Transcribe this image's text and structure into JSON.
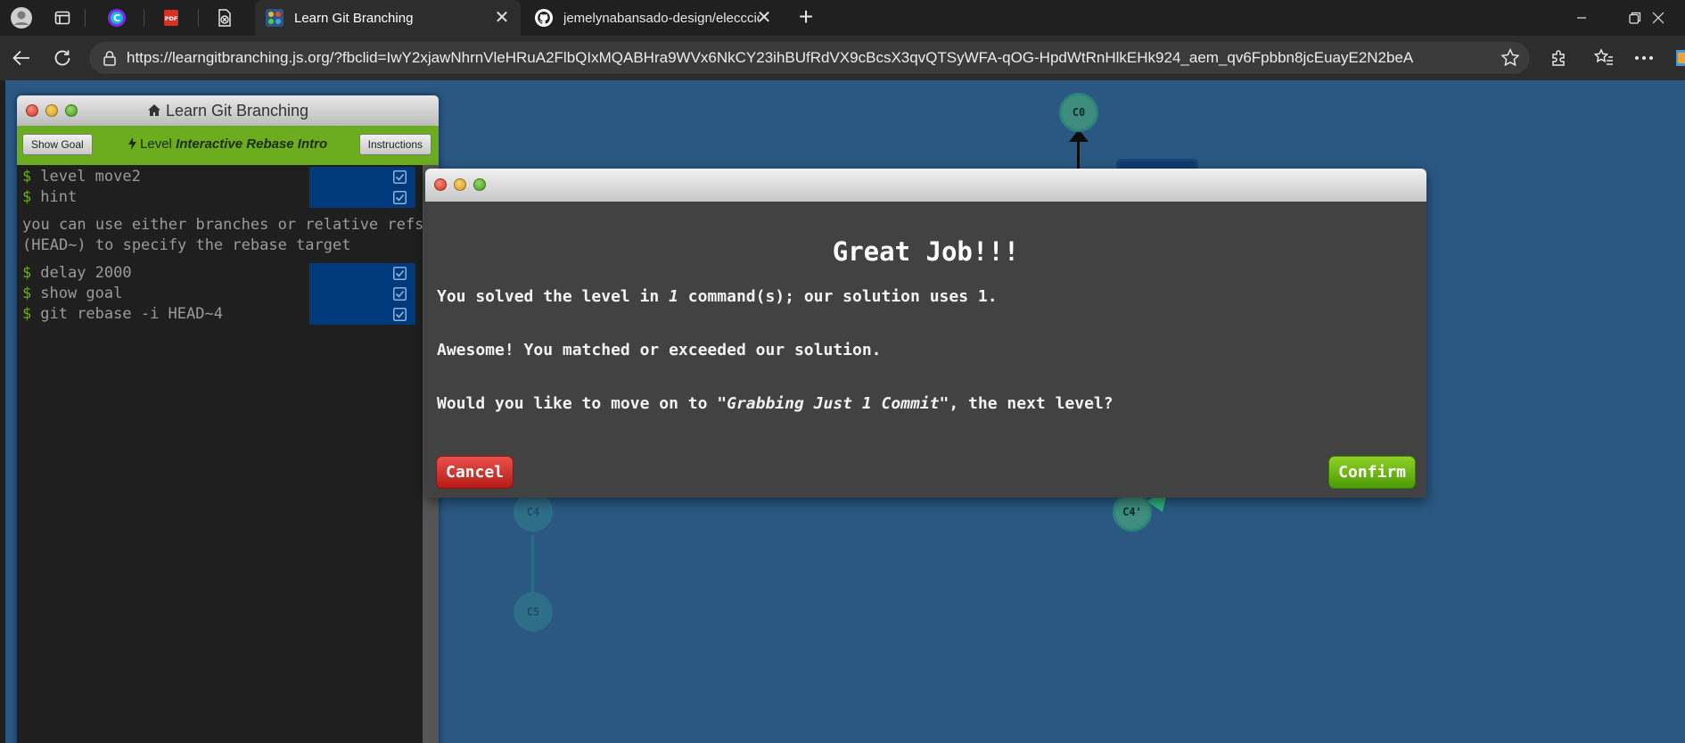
{
  "browser": {
    "tabs": [
      {
        "title": "Learn Git Branching",
        "active": true
      },
      {
        "title": "jemelynabansado-design/eleccción",
        "active": false
      }
    ],
    "close_glyph": "✕",
    "new_tab_glyph": "+",
    "url": "https://learngitbranching.js.org/?fbclid=IwY2xjawNhrnVleHRuA2FlbQIxMQABHra9WVx6NkCY23ihBUfRdVX9cBcsX3qvQTSyWFA-qOG-HpdWtRnHlkEHk924_aem_qv6Fpbbn8jcEuayE2N2beA"
  },
  "terminal": {
    "title": "Learn Git Branching",
    "show_goal_label": "Show Goal",
    "instructions_label": "Instructions",
    "level_prefix": "Level",
    "level_name": "Interactive Rebase Intro",
    "commands_top": [
      {
        "text": "level move2"
      },
      {
        "text": "hint"
      }
    ],
    "hint_text": "you can use either branches or relative refs (HEAD~) to specify the rebase target",
    "commands_bottom": [
      {
        "text": "delay 2000"
      },
      {
        "text": "show goal"
      },
      {
        "text": "git rebase -i HEAD~4"
      }
    ],
    "prompt": "$"
  },
  "tree": {
    "nodes": [
      {
        "label": "C0"
      },
      {
        "label": "C4"
      },
      {
        "label": "C5"
      },
      {
        "label": "C4'"
      }
    ]
  },
  "modal": {
    "heading": "Great Job!!!",
    "line1_a": "You solved the level in ",
    "line1_num": "1",
    "line1_b": " command(s); our solution uses 1.",
    "line2": "Awesome! You matched or exceeded our solution.",
    "line3_a": "Would you like to move on to ",
    "line3_level": "\"Grabbing Just 1 Commit\"",
    "line3_b": ", the next level?",
    "cancel_label": "Cancel",
    "confirm_label": "Confirm"
  },
  "colors": {
    "page_bg": "#2a5883",
    "level_bar": "#6bad1f",
    "cancel": "#c7221d",
    "confirm": "#6bb415"
  }
}
